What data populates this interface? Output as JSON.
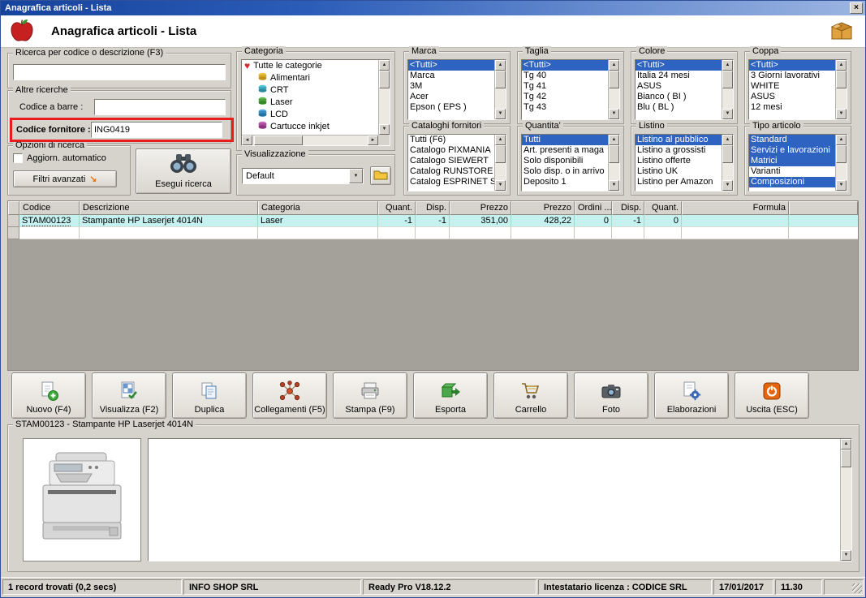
{
  "titlebar": {
    "title": "Anagrafica articoli  - Lista",
    "close": "×"
  },
  "header": {
    "title": "Anagrafica articoli  - Lista"
  },
  "icons": {
    "up": "▲",
    "down": "▼",
    "left": "◄",
    "right": "►",
    "dropdown": "▼",
    "heart": "♥",
    "advanced_arrow": "↘"
  },
  "search": {
    "main_label": "Ricerca per codice o descrizione (F3)",
    "main_value": "",
    "altre_label": "Altre ricerche",
    "barcode_label": "Codice a barre :",
    "barcode_value": "",
    "supplier_label": "Codice fornitore :",
    "supplier_value": "ING0419",
    "opzioni_label": "Opzioni di ricerca",
    "auto_label": "Aggiorn. automatico",
    "filtri_label": "Filtri avanzati",
    "esegui_label": "Esegui ricerca"
  },
  "categoria": {
    "label": "Categoria",
    "items": [
      "Tutte le categorie",
      "Alimentari",
      "CRT",
      "Laser",
      "LCD",
      "Cartucce inkjet"
    ]
  },
  "visualizzazione": {
    "label": "Visualizzazione",
    "value": "Default"
  },
  "filters": {
    "marca": {
      "label": "Marca",
      "items": [
        "<Tutti>",
        "Marca",
        "3M",
        "Acer",
        "Epson ( EPS )"
      ]
    },
    "cataloghi": {
      "label": "Cataloghi fornitori",
      "items": [
        "Tutti (F6)",
        "Catalogo PIXMANIA",
        "Catalogo SIEWERT",
        "Catalog RUNSTORE",
        "Catalog ESPRINET SPA"
      ]
    },
    "taglia": {
      "label": "Taglia",
      "items": [
        "<Tutti>",
        "Tg 40",
        "Tg 41",
        "Tg 42",
        "Tg 43"
      ]
    },
    "quantita": {
      "label": "Quantita'",
      "items": [
        "Tutti",
        "Art. presenti a maga",
        "Solo disponibili",
        "Solo disp. o in arrivo",
        "Deposito 1"
      ]
    },
    "colore": {
      "label": "Colore",
      "items": [
        "<Tutti>",
        "Italia 24 mesi",
        "ASUS",
        "Bianco ( BI )",
        "Blu ( BL )"
      ]
    },
    "listino": {
      "label": "Listino",
      "items": [
        "Listino al pubblico",
        "Listino a grossisti",
        "Listino offerte",
        "Listino UK",
        "Listino per Amazon"
      ]
    },
    "coppa": {
      "label": "Coppa",
      "items": [
        "<Tutti>",
        "3 Giorni lavorativi",
        "WHITE",
        "ASUS",
        "12 mesi"
      ]
    },
    "tipo": {
      "label": "Tipo articolo",
      "items": [
        "Standard",
        "Servizi e lavorazioni",
        "Matrici",
        "Varianti",
        "Composizioni"
      ]
    }
  },
  "grid": {
    "columns": [
      "Codice",
      "Descrizione",
      "Categoria",
      "Quant.",
      "Disp.",
      "Prezzo",
      "Prezzo",
      "Ordini ...",
      "Disp.",
      "Quant.",
      "Formula"
    ],
    "rows": [
      [
        "STAM00123",
        "Stampante HP Laserjet 4014N",
        "Laser",
        "-1",
        "-1",
        "351,00",
        "428,22",
        "0",
        "-1",
        "0",
        ""
      ]
    ]
  },
  "toolbar": {
    "buttons": [
      "Nuovo (F4)",
      "Visualizza (F2)",
      "Duplica",
      "Collegamenti (F5)",
      "Stampa (F9)",
      "Esporta",
      "Carrello",
      "Foto",
      "Elaborazioni",
      "Uscita (ESC)"
    ]
  },
  "detail": {
    "label": "STAM00123 - Stampante HP Laserjet 4014N"
  },
  "statusbar": {
    "records": "1 record trovati (0,2 secs)",
    "company": "INFO SHOP SRL",
    "version": "Ready Pro V18.12.2",
    "license": "Intestatario licenza : CODICE SRL",
    "date": "17/01/2017",
    "time": "11.30"
  },
  "colors": {
    "selection": "#2f63c1",
    "row_highlight": "#c6f1f1",
    "annotation": "#e81c1c",
    "titlebar_start": "#16439c",
    "titlebar_end": "#9db6e2"
  }
}
